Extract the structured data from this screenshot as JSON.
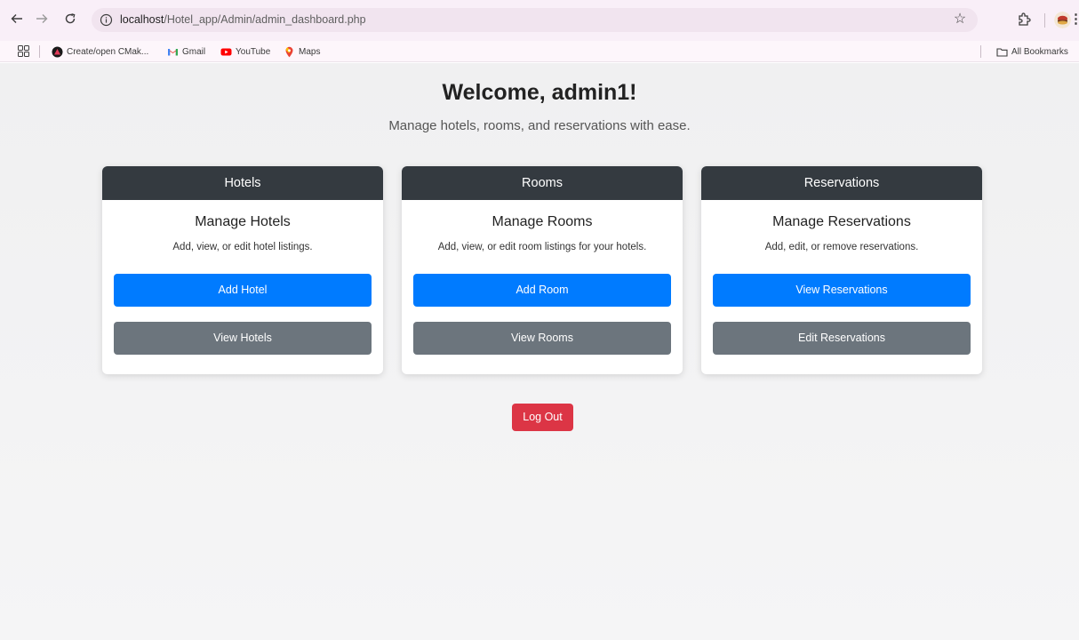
{
  "browser": {
    "url_host": "localhost",
    "url_path": "/Hotel_app/Admin/admin_dashboard.php",
    "bookmarks": [
      {
        "label": "Create/open CMak...",
        "icon": "cmake-icon"
      },
      {
        "label": "Gmail",
        "icon": "gmail-icon"
      },
      {
        "label": "YouTube",
        "icon": "youtube-icon"
      },
      {
        "label": "Maps",
        "icon": "maps-icon"
      }
    ],
    "all_bookmarks_label": "All Bookmarks"
  },
  "page": {
    "title": "Welcome, admin1!",
    "subtitle": "Manage hotels, rooms, and reservations with ease.",
    "cards": [
      {
        "header": "Hotels",
        "title": "Manage Hotels",
        "text": "Add, view, or edit hotel listings.",
        "primary_label": "Add Hotel",
        "secondary_label": "View Hotels"
      },
      {
        "header": "Rooms",
        "title": "Manage Rooms",
        "text": "Add, view, or edit room listings for your hotels.",
        "primary_label": "Add Room",
        "secondary_label": "View Rooms"
      },
      {
        "header": "Reservations",
        "title": "Manage Reservations",
        "text": "Add, edit, or remove reservations.",
        "primary_label": "View Reservations",
        "secondary_label": "Edit Reservations"
      }
    ],
    "logout_label": "Log Out"
  },
  "colors": {
    "card_header": "#343a40",
    "primary": "#007bff",
    "secondary": "#6c757d",
    "danger": "#dc3545",
    "chrome_toolbar": "#f9eff8"
  }
}
